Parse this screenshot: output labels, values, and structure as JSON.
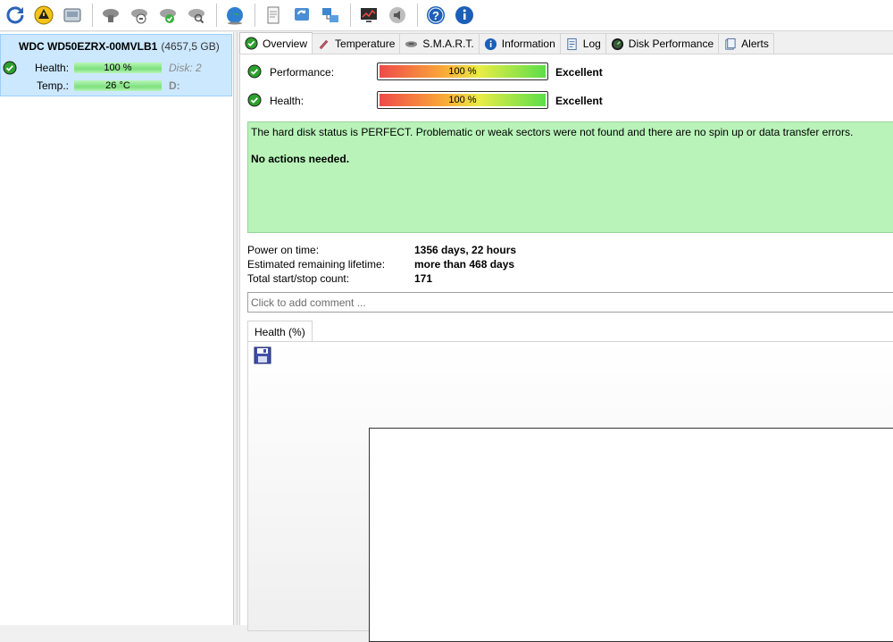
{
  "toolbar": {
    "buttons": [
      "refresh-icon",
      "warning-icon",
      "hard-drive-icon",
      "drive-gray-icon",
      "drive-refresh-icon",
      "drive-check-icon",
      "drive-search-icon",
      "globe-icon",
      "document-icon",
      "network-refresh-icon",
      "network-icon",
      "monitor-chart-icon",
      "speaker-icon",
      "help-icon",
      "info-icon"
    ]
  },
  "disk": {
    "name": "WDC WD50EZRX-00MVLB1",
    "size": "(4657,5 GB)",
    "health_label": "Health:",
    "health_value": "100 %",
    "health_level": 1.0,
    "disk_label": "Disk: 2",
    "temp_label": "Temp.:",
    "temp_value": "26 °C",
    "drive_letter": "D:"
  },
  "tabs": [
    {
      "label": "Overview",
      "icon": "check-icon",
      "active": true
    },
    {
      "label": "Temperature",
      "icon": "thermometer-icon"
    },
    {
      "label": "S.M.A.R.T.",
      "icon": "drive-smart-icon"
    },
    {
      "label": "Information",
      "icon": "info-icon"
    },
    {
      "label": "Log",
      "icon": "log-icon"
    },
    {
      "label": "Disk Performance",
      "icon": "gauge-icon"
    },
    {
      "label": "Alerts",
      "icon": "alerts-icon"
    }
  ],
  "overview": {
    "performance": {
      "label": "Performance:",
      "value": "100 %",
      "level": 1.0,
      "verdict": "Excellent"
    },
    "health": {
      "label": "Health:",
      "value": "100 %",
      "level": 1.0,
      "verdict": "Excellent"
    },
    "status_message": "The hard disk status is PERFECT. Problematic or weak sectors were not found and there are no spin up or data transfer errors.",
    "action_message": "No actions needed.",
    "info": [
      {
        "key": "Power on time:",
        "value": "1356 days, 22 hours"
      },
      {
        "key": "Estimated remaining lifetime:",
        "value": "more than 468 days"
      },
      {
        "key": "Total start/stop count:",
        "value": "171"
      }
    ],
    "comment_placeholder": "Click to add comment ...",
    "chart_tab": "Health (%)"
  },
  "colors": {
    "selection": "#cce8ff",
    "status_ok": "#b9f3b9",
    "check_green": "#1f9d1f"
  }
}
